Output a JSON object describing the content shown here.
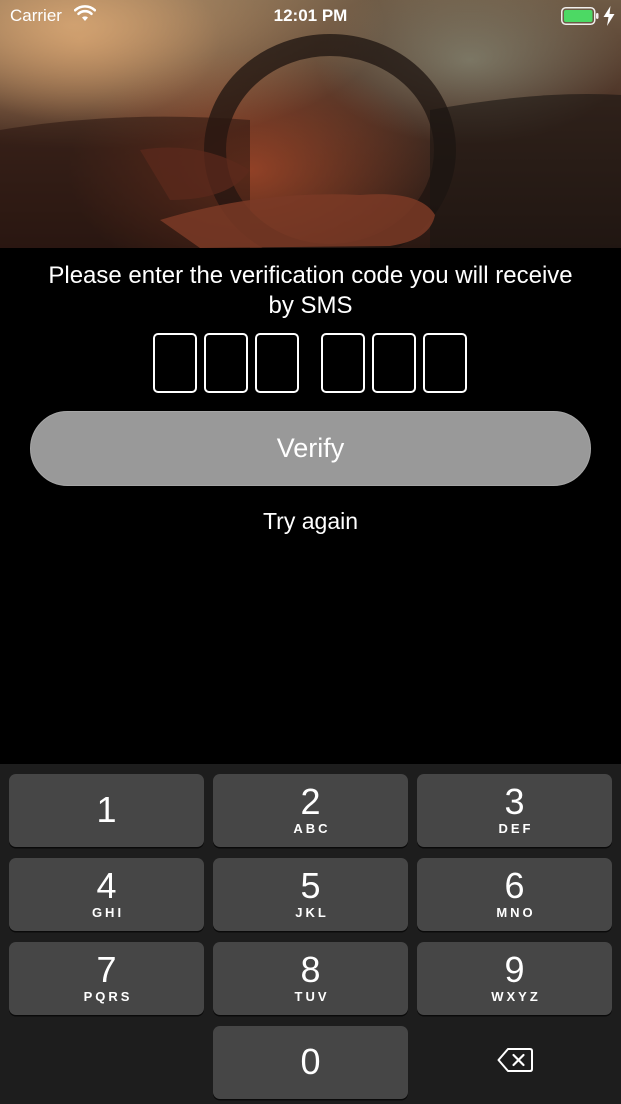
{
  "status_bar": {
    "carrier": "Carrier",
    "time": "12:01 PM",
    "battery_color": "#4cd964"
  },
  "verification": {
    "prompt": "Please enter the verification code you will receive by SMS",
    "code_length": 6,
    "verify_label": "Verify",
    "try_again_label": "Try again"
  },
  "keypad": {
    "keys": [
      {
        "digit": "1",
        "letters": ""
      },
      {
        "digit": "2",
        "letters": "ABC"
      },
      {
        "digit": "3",
        "letters": "DEF"
      },
      {
        "digit": "4",
        "letters": "GHI"
      },
      {
        "digit": "5",
        "letters": "JKL"
      },
      {
        "digit": "6",
        "letters": "MNO"
      },
      {
        "digit": "7",
        "letters": "PQRS"
      },
      {
        "digit": "8",
        "letters": "TUV"
      },
      {
        "digit": "9",
        "letters": "WXYZ"
      },
      {
        "digit": "0",
        "letters": ""
      }
    ],
    "delete_icon": "backspace-icon"
  },
  "colors": {
    "background": "#000000",
    "button_disabled": "#999999",
    "key_background": "#464646",
    "keypad_background": "#1d1d1d"
  }
}
